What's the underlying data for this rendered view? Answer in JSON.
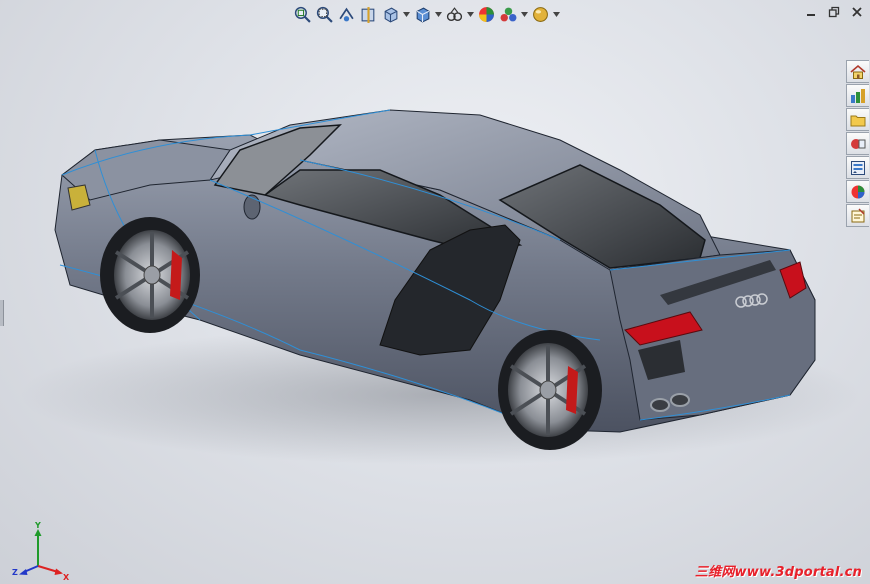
{
  "toolbar": {
    "items": [
      {
        "icon": "zoom-to-fit-icon",
        "dropdown": false
      },
      {
        "icon": "zoom-to-area-icon",
        "dropdown": false
      },
      {
        "icon": "previous-view-icon",
        "dropdown": false
      },
      {
        "icon": "section-view-icon",
        "dropdown": false
      },
      {
        "icon": "view-orientation-icon",
        "dropdown": true
      },
      {
        "icon": "display-style-icon",
        "dropdown": true
      },
      {
        "icon": "hide-show-items-icon",
        "dropdown": true
      },
      {
        "icon": "edit-appearance-icon",
        "dropdown": false
      },
      {
        "icon": "apply-scene-icon",
        "dropdown": true
      },
      {
        "icon": "view-settings-icon",
        "dropdown": true
      }
    ]
  },
  "window_controls": [
    "minimize-icon",
    "restore-icon",
    "close-icon"
  ],
  "task_pane": {
    "tabs": [
      "home-icon",
      "design-library-icon",
      "file-explorer-icon",
      "view-palette-icon",
      "appearances-icon",
      "custom-properties-icon"
    ]
  },
  "triad": {
    "x": "X",
    "y": "Y",
    "z": "Z"
  },
  "watermark": "三维网www.3dportal.cn",
  "colors": {
    "background": "#dfe2e8",
    "car_body": "#6c7382",
    "edge_lines": "#2f8fd6",
    "glass": "#2a2d31",
    "tail_light": "#c8101c",
    "brake_caliper": "#c41a1a",
    "watermark": "#e8202a"
  }
}
